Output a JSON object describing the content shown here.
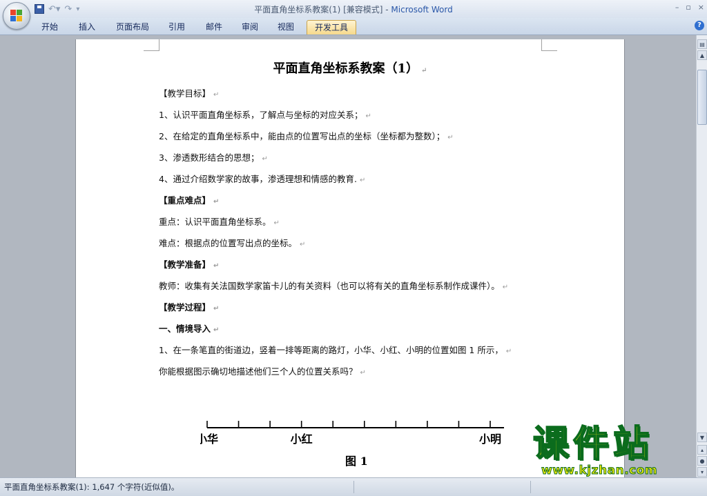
{
  "window": {
    "title_doc": "平面直角坐标系教案(1) [兼容模式] - ",
    "title_app": "Microsoft Word",
    "controls": [
      "–",
      "▫",
      "×"
    ]
  },
  "ribbon": {
    "tabs": [
      "开始",
      "插入",
      "页面布局",
      "引用",
      "邮件",
      "审阅",
      "视图",
      "开发工具"
    ],
    "active_tab": "开发工具",
    "help": "?"
  },
  "document": {
    "title": "平面直角坐标系教案（1）",
    "paragraph_mark": "↵",
    "paragraphs": [
      {
        "text": "【教学目标】",
        "bold": false
      },
      {
        "text": "1、认识平面直角坐标系，了解点与坐标的对应关系；",
        "bold": false
      },
      {
        "text": "2、在给定的直角坐标系中，能由点的位置写出点的坐标（坐标都为整数）；",
        "bold": false
      },
      {
        "text": "3、渗透数形结合的思想；",
        "bold": false
      },
      {
        "text": "4、通过介绍数学家的故事，渗透理想和情感的教育.",
        "bold": false
      },
      {
        "text": "【重点难点】",
        "bold": true
      },
      {
        "text": "重点：认识平面直角坐标系。",
        "bold": false
      },
      {
        "text": "难点：根据点的位置写出点的坐标。",
        "bold": false
      },
      {
        "text": "【教学准备】",
        "bold": true
      },
      {
        "text": "教师：收集有关法国数学家笛卡儿的有关资料（也可以将有关的直角坐标系制作成课件）。",
        "bold": false
      },
      {
        "text": "【教学过程】",
        "bold": true
      },
      {
        "text": "一、情境导入",
        "bold": true
      },
      {
        "text": "1、在一条笔直的街道边，竖着一排等距离的路灯，小华、小红、小明的位置如图 1 所示，",
        "bold": false
      },
      {
        "text": "你能根据图示确切地描述他们三个人的位置关系吗？",
        "bold": false
      }
    ],
    "figure": {
      "tick_count": 10,
      "labels": [
        {
          "text": "小华",
          "tick": 0
        },
        {
          "text": "小红",
          "tick": 3
        },
        {
          "text": "小明",
          "tick": 9
        }
      ],
      "caption": "图 1"
    }
  },
  "status": {
    "text": "平面直角坐标系教案(1): 1,647 个字符(近似值)。"
  },
  "watermark": {
    "main": "课件站",
    "url": "www.kjzhan.com"
  }
}
